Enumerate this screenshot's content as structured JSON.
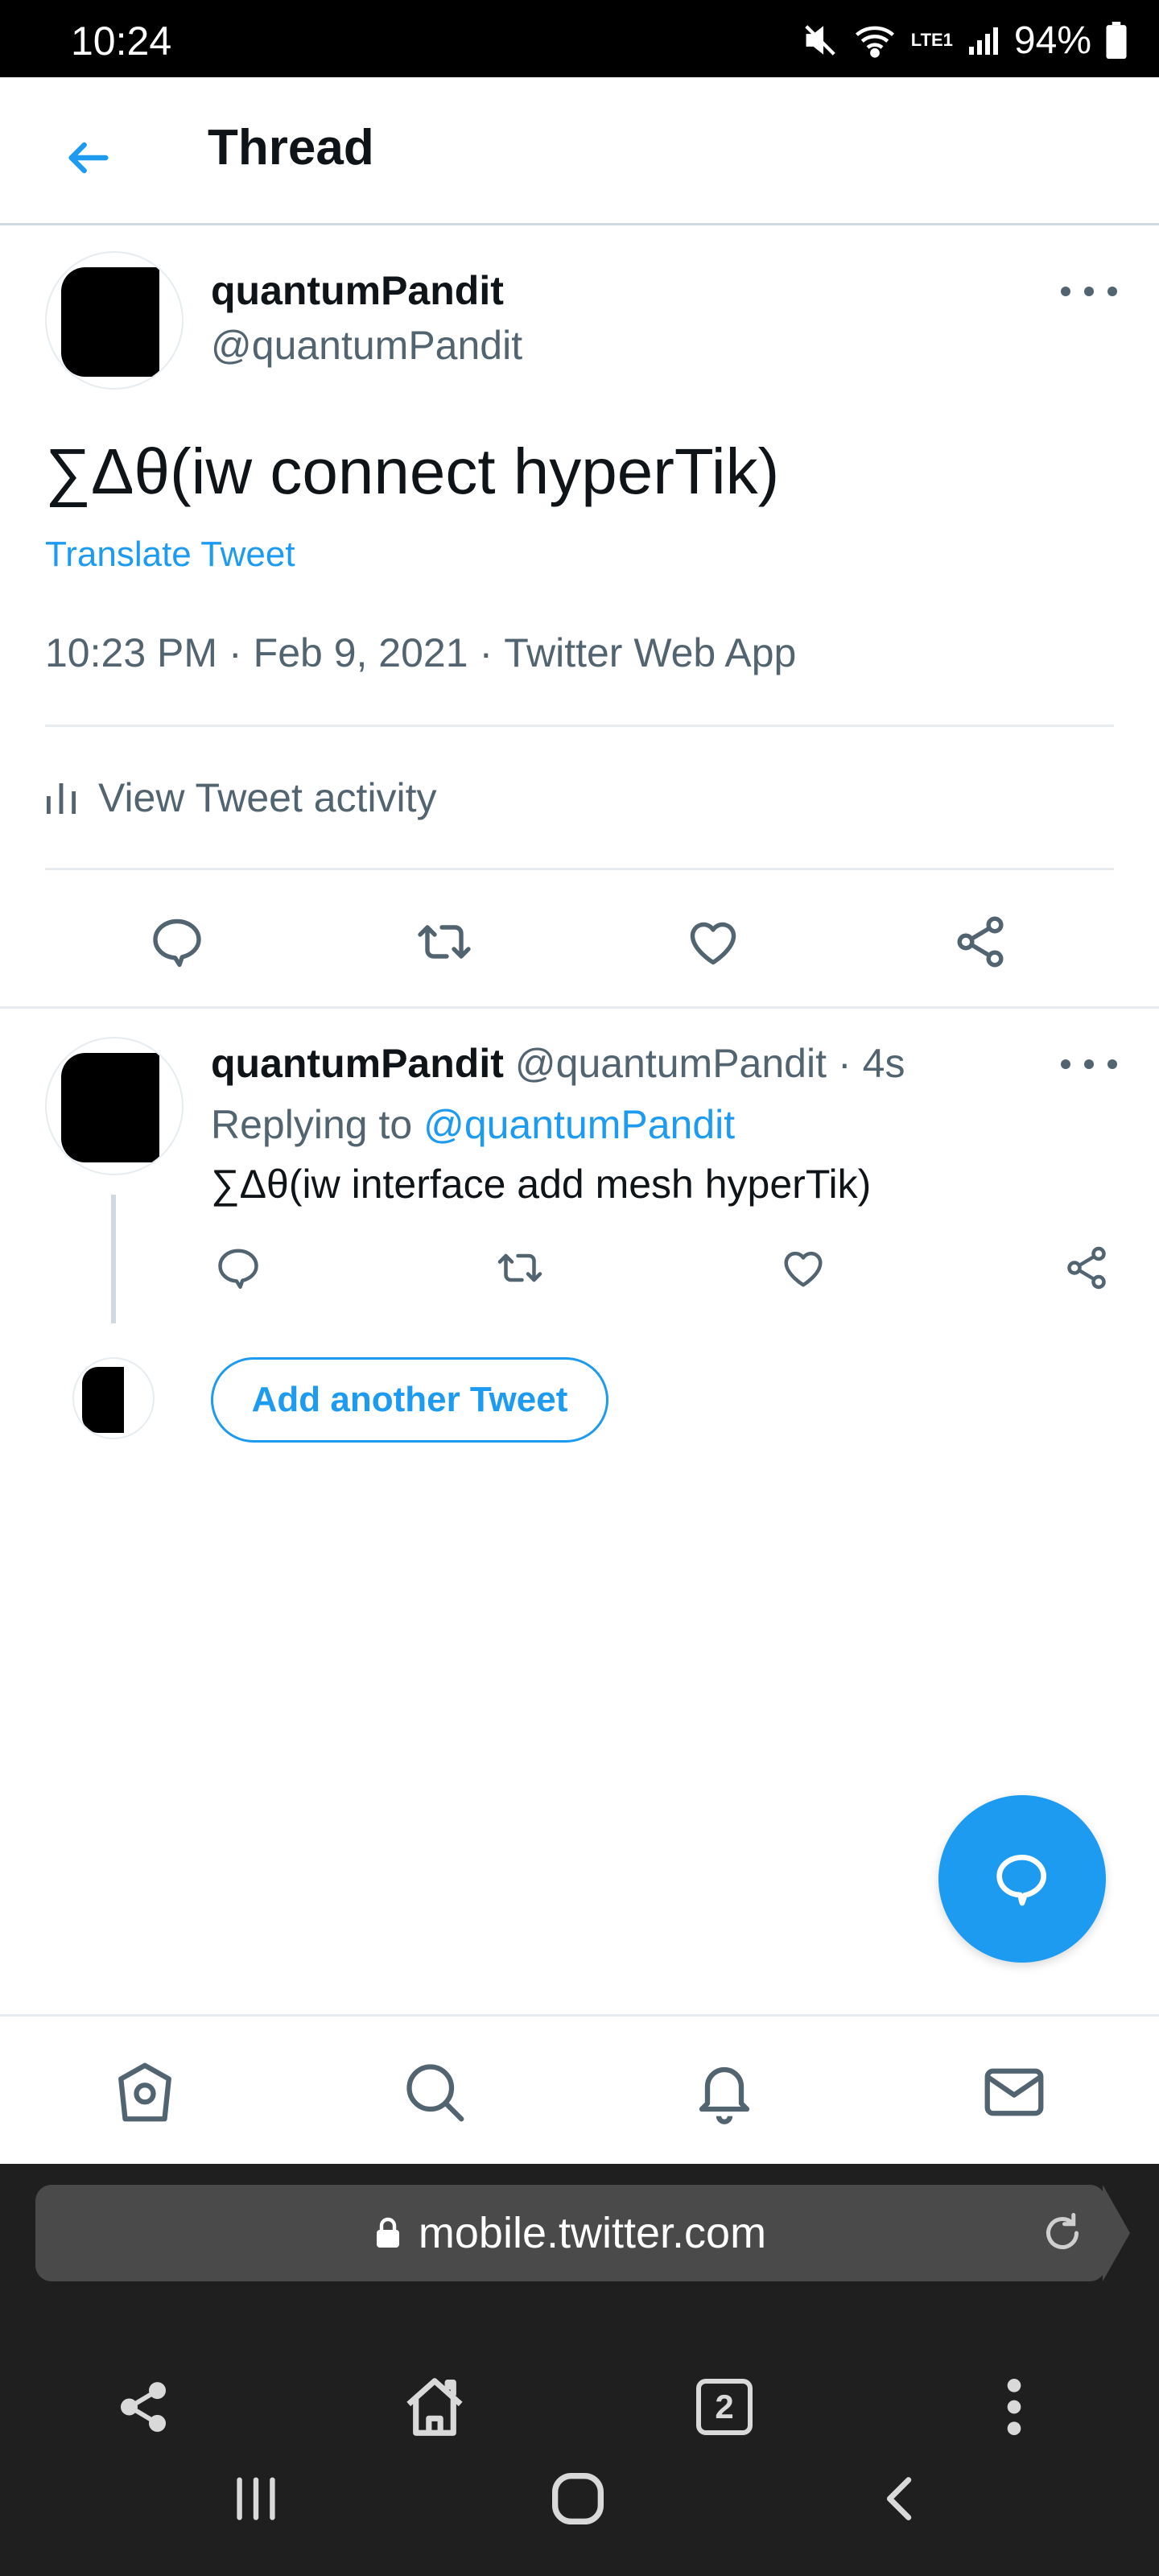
{
  "status_bar": {
    "time": "10:24",
    "battery": "94%",
    "network": "LTE1"
  },
  "header": {
    "title": "Thread"
  },
  "main_tweet": {
    "name": "quantumPandit",
    "handle": "@quantumPandit",
    "text": "∑Δθ(iw connect hyperTik)",
    "translate_label": "Translate Tweet",
    "time": "10:23 PM",
    "date": "Feb 9, 2021",
    "source": "Twitter Web App",
    "activity_label": "View Tweet activity"
  },
  "reply_tweet": {
    "name": "quantumPandit",
    "handle": "@quantumPandit",
    "age": "4s",
    "replying_prefix": "Replying to",
    "replying_handle": "@quantumPandit",
    "text": "∑Δθ(iw interface add mesh hyperTik)"
  },
  "composer": {
    "add_label": "Add another Tweet"
  },
  "browser": {
    "url": "mobile.twitter.com",
    "tabs_count": "2"
  },
  "colors": {
    "accent": "#1d9bf0",
    "text": "#0f1419",
    "muted": "#536471"
  },
  "icons": {
    "nav": [
      "home-icon",
      "search-icon",
      "bell-icon",
      "mail-icon"
    ],
    "actions": [
      "reply-icon",
      "retweet-icon",
      "like-icon",
      "share-icon"
    ]
  }
}
